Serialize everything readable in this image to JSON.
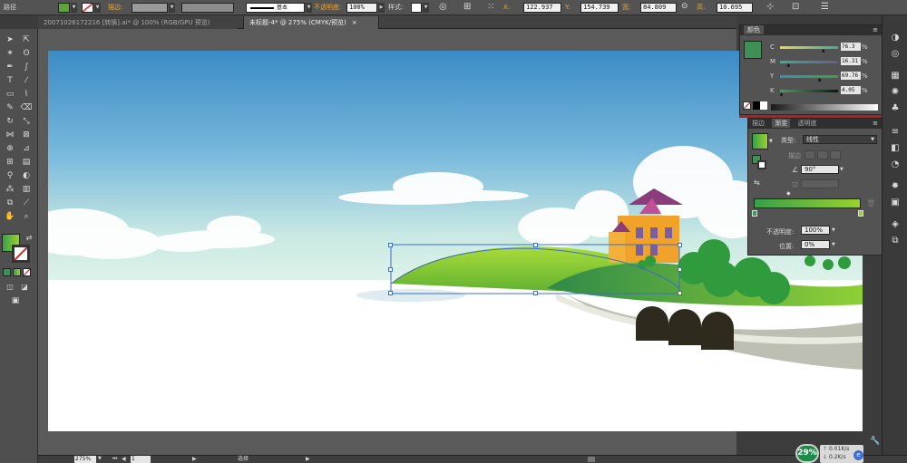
{
  "topbar": {
    "path_label": "路径",
    "stroke_label": "描边:",
    "stroke_profile": "基本",
    "opacity_label": "不透明度:",
    "opacity_value": "100%",
    "style_label": "样式:",
    "x_label": "X:",
    "x_value": "122.937",
    "y_label": "Y:",
    "y_value": "154.739",
    "w_label": "宽:",
    "w_value": "84.809",
    "h_label": "高:",
    "h_value": "10.695"
  },
  "tabs": [
    {
      "label": "20071026172216 [转换].ai* @ 100% (RGB/GPU 预览)",
      "active": false
    },
    {
      "label": "未标题-4* @ 275% (CMYK/预览)",
      "active": true
    }
  ],
  "color_panel": {
    "title": "颜色",
    "swatch": "#3f8f56",
    "channels": [
      {
        "label": "C",
        "value": "76.3",
        "unit": "%",
        "level": 0.763
      },
      {
        "label": "M",
        "value": "16.31",
        "unit": "%",
        "level": 0.163
      },
      {
        "label": "Y",
        "value": "69.76",
        "unit": "%",
        "level": 0.698
      },
      {
        "label": "K",
        "value": "4.05",
        "unit": "%",
        "level": 0.04
      }
    ]
  },
  "gradient_panel": {
    "tabs": [
      "描边",
      "渐变",
      "透明度"
    ],
    "active_tab": "渐变",
    "type_label": "类型:",
    "type_value": "线性",
    "stroke_label": "描边",
    "angle_value": "90°",
    "opacity_label": "不透明度:",
    "opacity_value": "100%",
    "location_label": "位置:",
    "location_value": "0%",
    "colors": {
      "start": "#37a04a",
      "end": "#9bd12e"
    }
  },
  "status": {
    "zoom": "275%",
    "page": "1",
    "mode": "选择"
  },
  "network": {
    "percent": "29%",
    "up": "0.01K/s",
    "down": "0.2K/s"
  }
}
